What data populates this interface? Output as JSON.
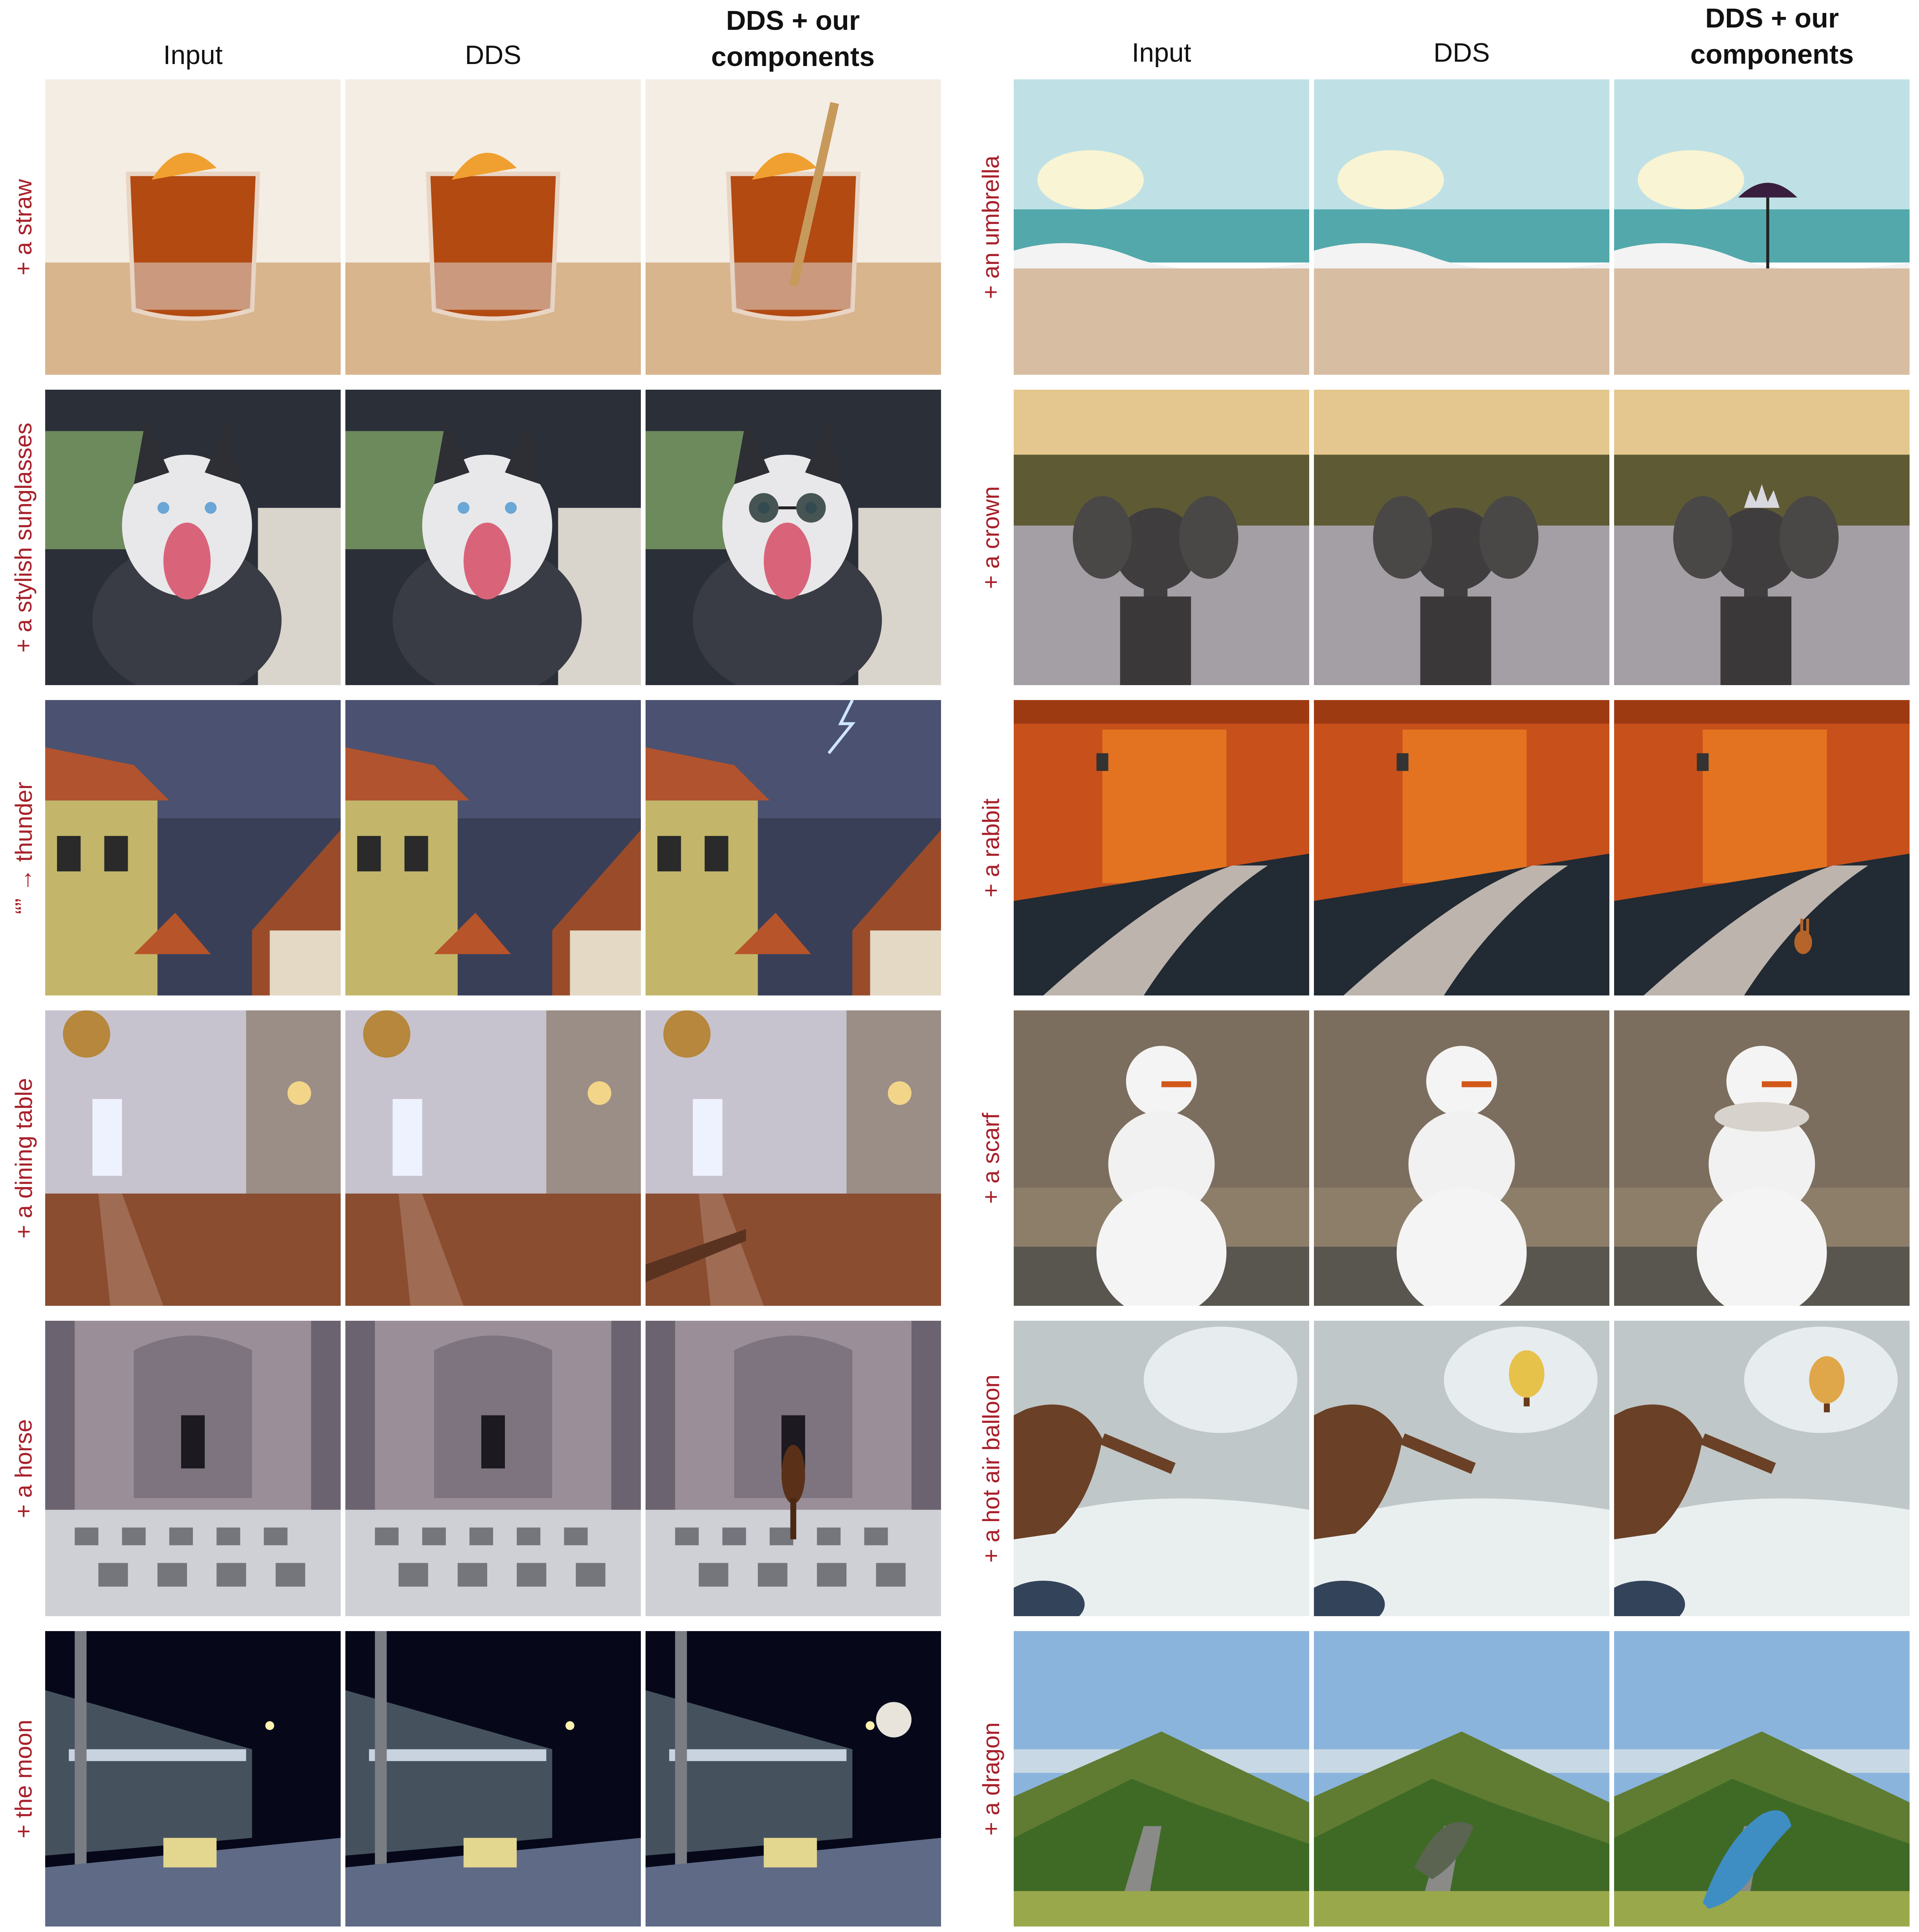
{
  "headers": {
    "left": {
      "input": "Input",
      "dds": "DDS",
      "ours": "DDS + our components"
    },
    "right": {
      "input": "Input",
      "dds": "DDS",
      "ours": "DDS + our components"
    }
  },
  "rows": {
    "left": [
      "+ a straw",
      "+ a stylish sunglasses",
      "“” → thunder",
      "+ a dining table",
      "+ a horse",
      "+ the moon"
    ],
    "right": [
      "+ an umbrella",
      "+ a crown",
      "+ a rabbit",
      "+ a scarf",
      "+ a hot air balloon",
      "+ a dragon"
    ]
  },
  "colors": {
    "label": "#a8202a",
    "header": "#111111"
  }
}
